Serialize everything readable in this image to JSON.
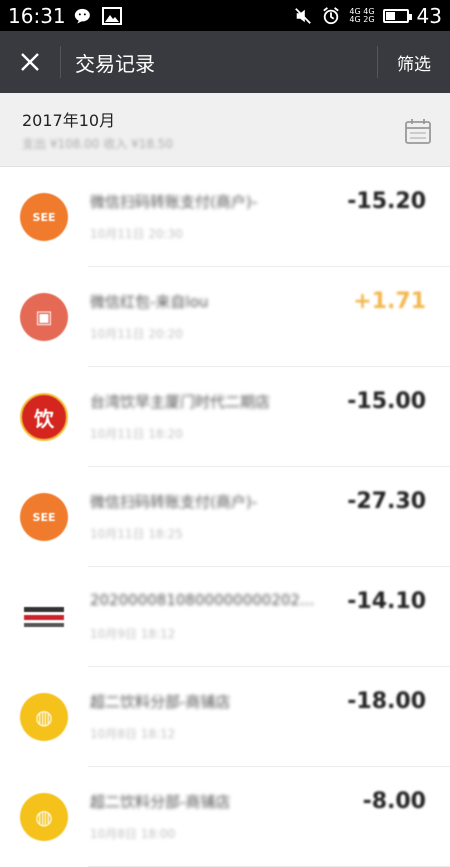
{
  "status_bar": {
    "time": "16:31",
    "left_icons": [
      "wechat-icon",
      "image-icon"
    ],
    "right_icons": [
      "mute-icon",
      "alarm-icon",
      "signal-icon",
      "battery-icon"
    ],
    "network_top": "4G 4G",
    "network_bottom": "4G 2G",
    "battery_level": "43"
  },
  "app_bar": {
    "title": "交易记录",
    "close_icon": "close-icon",
    "filter_label": "筛选"
  },
  "month_header": {
    "month": "2017年10月",
    "summary": "支出 ¥108.00  收入 ¥18.50",
    "calendar_icon": "calendar-icon"
  },
  "transactions": [
    {
      "title": "微信扫码转账支付(商户)-",
      "time": "10月11日 20:30",
      "amount": "-15.20",
      "type": "out",
      "avatar_text": "SEE",
      "avatar_color": "#f07b2c"
    },
    {
      "title": "微信红包-来自lou",
      "time": "10月11日 20:20",
      "amount": "+1.71",
      "type": "in",
      "avatar_text": "▣",
      "avatar_color": "#e46a55"
    },
    {
      "title": "台湾饮早主厦门时代二期店",
      "time": "10月11日 18:20",
      "amount": "-15.00",
      "type": "out",
      "avatar_text": "饮",
      "avatar_color": "#d4261f"
    },
    {
      "title": "微信扫码转账支付(商户)-",
      "time": "10月11日 18:25",
      "amount": "-27.30",
      "type": "out",
      "avatar_text": "SEE",
      "avatar_color": "#f07b2c"
    },
    {
      "title": "2020000810800000000202...",
      "time": "10月9日 18:12",
      "amount": "-14.10",
      "type": "out",
      "avatar_text": "≡",
      "avatar_color": "#ffffff"
    },
    {
      "title": "超二饮料分部-商铺店",
      "time": "10月8日 18:12",
      "amount": "-18.00",
      "type": "out",
      "avatar_text": "◍",
      "avatar_color": "#f4c21b"
    },
    {
      "title": "超二饮料分部-商铺店",
      "time": "10月8日 18:00",
      "amount": "-8.00",
      "type": "out",
      "avatar_text": "◍",
      "avatar_color": "#f4c21b"
    }
  ]
}
